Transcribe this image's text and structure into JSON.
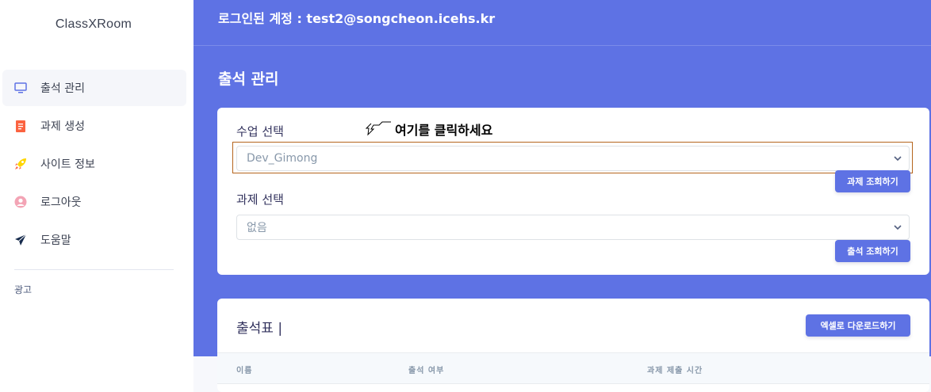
{
  "brand": "ClassXRoom",
  "sidebar": {
    "items": [
      {
        "label": "출석 관리",
        "icon": "monitor-icon",
        "active": true,
        "color": "#5e72e4"
      },
      {
        "label": "과제 생성",
        "icon": "document-icon",
        "active": false,
        "color": "#fb6340"
      },
      {
        "label": "사이트 정보",
        "icon": "rocket-icon",
        "active": false,
        "color": "#ffd600"
      },
      {
        "label": "로그아웃",
        "icon": "user-icon",
        "active": false,
        "color": "#f3a4b5"
      },
      {
        "label": "도움말",
        "icon": "send-icon",
        "active": false,
        "color": "#172b4d"
      }
    ],
    "ads_label": "광고"
  },
  "header": {
    "account": "로그인된 계정 : test2@songcheon.icehs.kr",
    "page_title": "출석 관리"
  },
  "form": {
    "class_label": "수업 선택",
    "class_value": "Dev_Gimong",
    "hint": "여기를 클릭하세요",
    "assignment_query_button": "과제 조회하기",
    "assignment_label": "과제 선택",
    "assignment_value": "없음",
    "attendance_query_button": "출석 조회하기"
  },
  "table": {
    "title": "출석표 |",
    "download_button": "엑셀로 다운로드하기",
    "columns": [
      "이름",
      "출석 여부",
      "과제 제출 시간"
    ]
  },
  "colors": {
    "primary": "#5e72e4",
    "highlight_border": "#b5651d"
  }
}
